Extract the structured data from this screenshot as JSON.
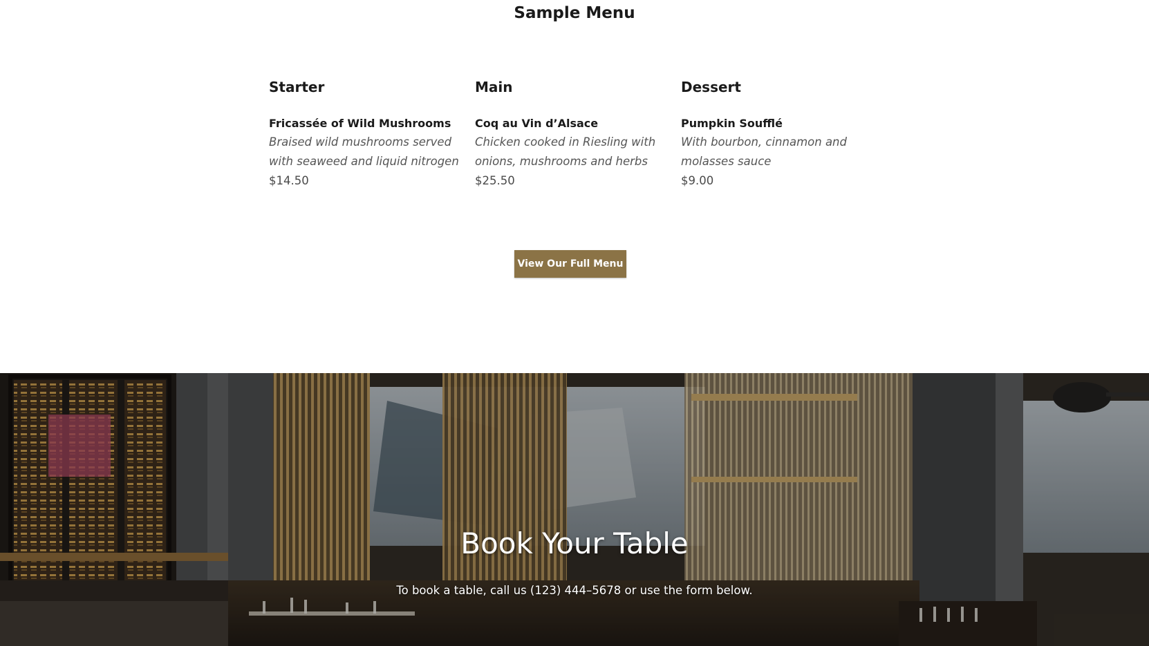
{
  "menu": {
    "title": "Sample Menu",
    "courses": [
      {
        "heading": "Starter",
        "dish": "Fricassée of Wild Mushrooms",
        "description_line1": "Braised wild mushrooms served",
        "description_line2": "with seaweed and liquid nitrogen",
        "price": "$14.50"
      },
      {
        "heading": "Main",
        "dish": "Coq au Vin d’Alsace",
        "description_line1": "Chicken cooked in Riesling with",
        "description_line2": "onions, mushrooms and herbs",
        "price": "$25.50"
      },
      {
        "heading": "Dessert",
        "dish": "Pumpkin Soufflé",
        "description_line1": "With bourbon, cinnamon and",
        "description_line2": "molasses sauce",
        "price": "$9.00"
      }
    ],
    "button_label": "View Our Full Menu",
    "accent_color": "#8b7346"
  },
  "booking": {
    "title": "Book Your Table",
    "subtitle": "To book a table, call us (123) 444–5678 or use the form below.",
    "background_image": "restaurant-interior-photo"
  }
}
